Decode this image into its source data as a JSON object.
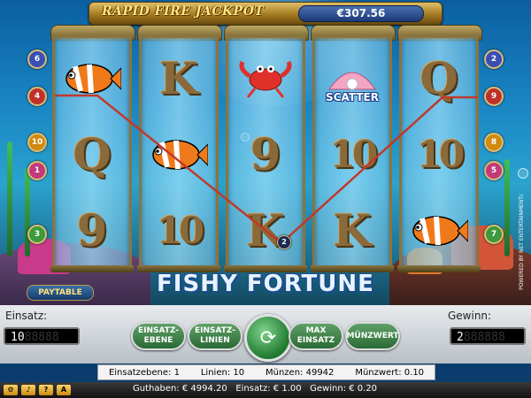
{
  "jackpot": {
    "label": "RAPID FIRE JACKPOT",
    "value": "€307.56"
  },
  "game_title": "FISHY FORTUNE",
  "paytable_label": "PAYTABLE",
  "reels": [
    [
      "clownfish-icon",
      "Q",
      "9"
    ],
    [
      "K",
      "clownfish-icon",
      "10"
    ],
    [
      "crab-icon",
      "9",
      "K"
    ],
    [
      "SCATTER",
      "10",
      "K"
    ],
    [
      "Q",
      "10",
      "clownfish-icon"
    ]
  ],
  "left_line_markers": [
    "6",
    "4",
    "10",
    "1",
    "3"
  ],
  "right_line_markers": [
    "2",
    "9",
    "8",
    "5",
    "7"
  ],
  "active_line_badge": "2",
  "panel": {
    "einsatz_label": "Einsatz:",
    "einsatz_value": "10",
    "gewinn_label": "Gewinn:",
    "gewinn_value": "2",
    "buttons": {
      "einsatz_ebene": "EINSATZ-EBENE",
      "einsatz_linien": "EINSATZ-LINIEN",
      "max_einsatz": "MAX EINSATZ",
      "munzwert": "MÜNZWERT"
    }
  },
  "info_bar": {
    "einsatzebene": "Einsatzebene: 1",
    "linien": "Linien: 10",
    "munzen": "Münzen: 49942",
    "munzwert": "Münzwert: 0.10"
  },
  "status_bar": {
    "guthaben": "Guthaben: € 4994.20",
    "einsatz": "Einsatz: € 1.00",
    "gewinn": "Gewinn: € 0.20"
  },
  "powered_by": "POWERED BY NET ENTERTAINMENT™",
  "colors": {
    "win_line": "#c0392b",
    "panel_button": "#3d8a48",
    "jackpot_gold": "#c9a23c"
  }
}
